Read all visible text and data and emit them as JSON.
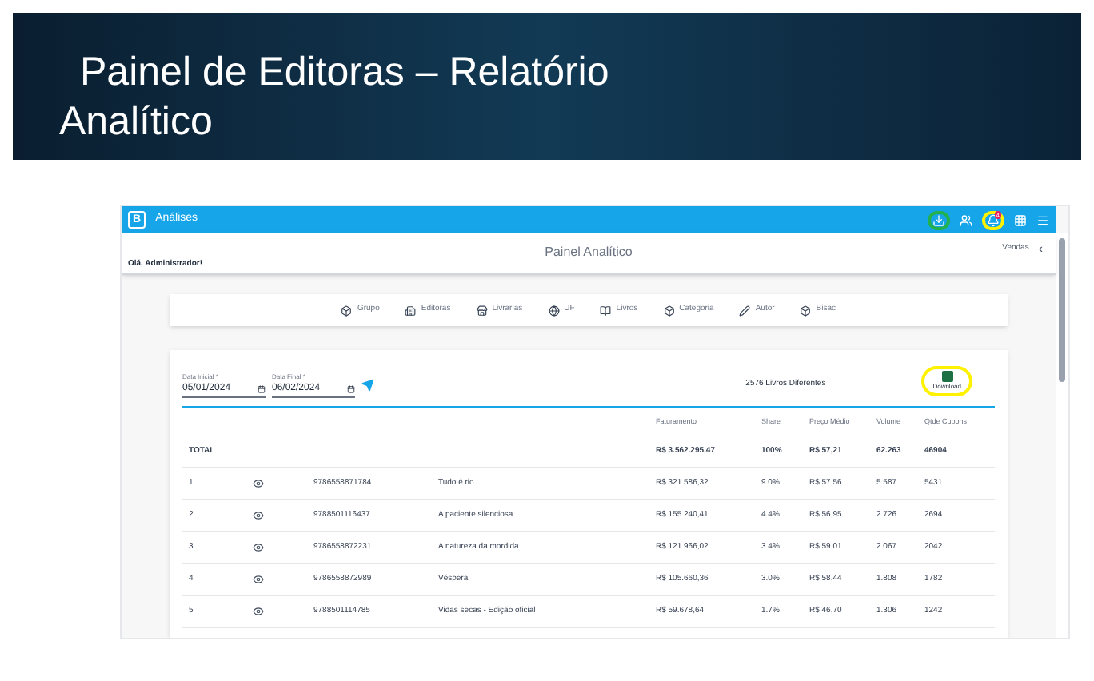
{
  "slide": {
    "title_lines": [
      "Painel de Editoras – Relatório",
      "Analítico"
    ]
  },
  "app": {
    "bar_title": "Análises",
    "logo": "B",
    "notification_count": "4",
    "greeting": "Olá, Administrador!",
    "page_title": "Painel Analítico",
    "section": "Vendas",
    "back": "‹"
  },
  "filters": [
    {
      "label": "Grupo"
    },
    {
      "label": "Editoras"
    },
    {
      "label": "Livrarias"
    },
    {
      "label": "UF"
    },
    {
      "label": "Livros"
    },
    {
      "label": "Categoria"
    },
    {
      "label": "Autor"
    },
    {
      "label": "Bisac"
    }
  ],
  "dates": [
    {
      "label": "Data Inicial *",
      "value": "05/01/2024"
    },
    {
      "label": "Data Final *",
      "value": "06/02/2024"
    }
  ],
  "summary": "2576 Livros Diferentes",
  "export": {
    "label": "Download"
  },
  "table": {
    "columns": [
      "Faturamento",
      "Share",
      "Preço Médio",
      "Volume",
      "Qtde Cupons"
    ],
    "total": {
      "label": "TOTAL",
      "values": [
        "R$ 3.562.295,47",
        "100%",
        "R$ 57,21",
        "62.263",
        "46904"
      ]
    },
    "rows": [
      {
        "rank": "1",
        "isbn": "9786558871784",
        "title": "Tudo é rio",
        "values": [
          "R$ 321.586,32",
          "9.0%",
          "R$ 57,56",
          "5.587",
          "5431"
        ]
      },
      {
        "rank": "2",
        "isbn": "9788501116437",
        "title": "A paciente silenciosa",
        "values": [
          "R$ 155.240,41",
          "4.4%",
          "R$ 56,95",
          "2.726",
          "2694"
        ]
      },
      {
        "rank": "3",
        "isbn": "9786558872231",
        "title": "A natureza da mordida",
        "values": [
          "R$ 121.966,02",
          "3.4%",
          "R$ 59,01",
          "2.067",
          "2042"
        ]
      },
      {
        "rank": "4",
        "isbn": "9786558872989",
        "title": "Véspera",
        "values": [
          "R$ 105.660,36",
          "3.0%",
          "R$ 58,44",
          "1.808",
          "1782"
        ]
      },
      {
        "rank": "5",
        "isbn": "9788501114785",
        "title": "Vidas secas - Edição oficial",
        "values": [
          "R$ 59.678,64",
          "1.7%",
          "R$ 46,70",
          "1.306",
          "1242"
        ]
      }
    ]
  }
}
